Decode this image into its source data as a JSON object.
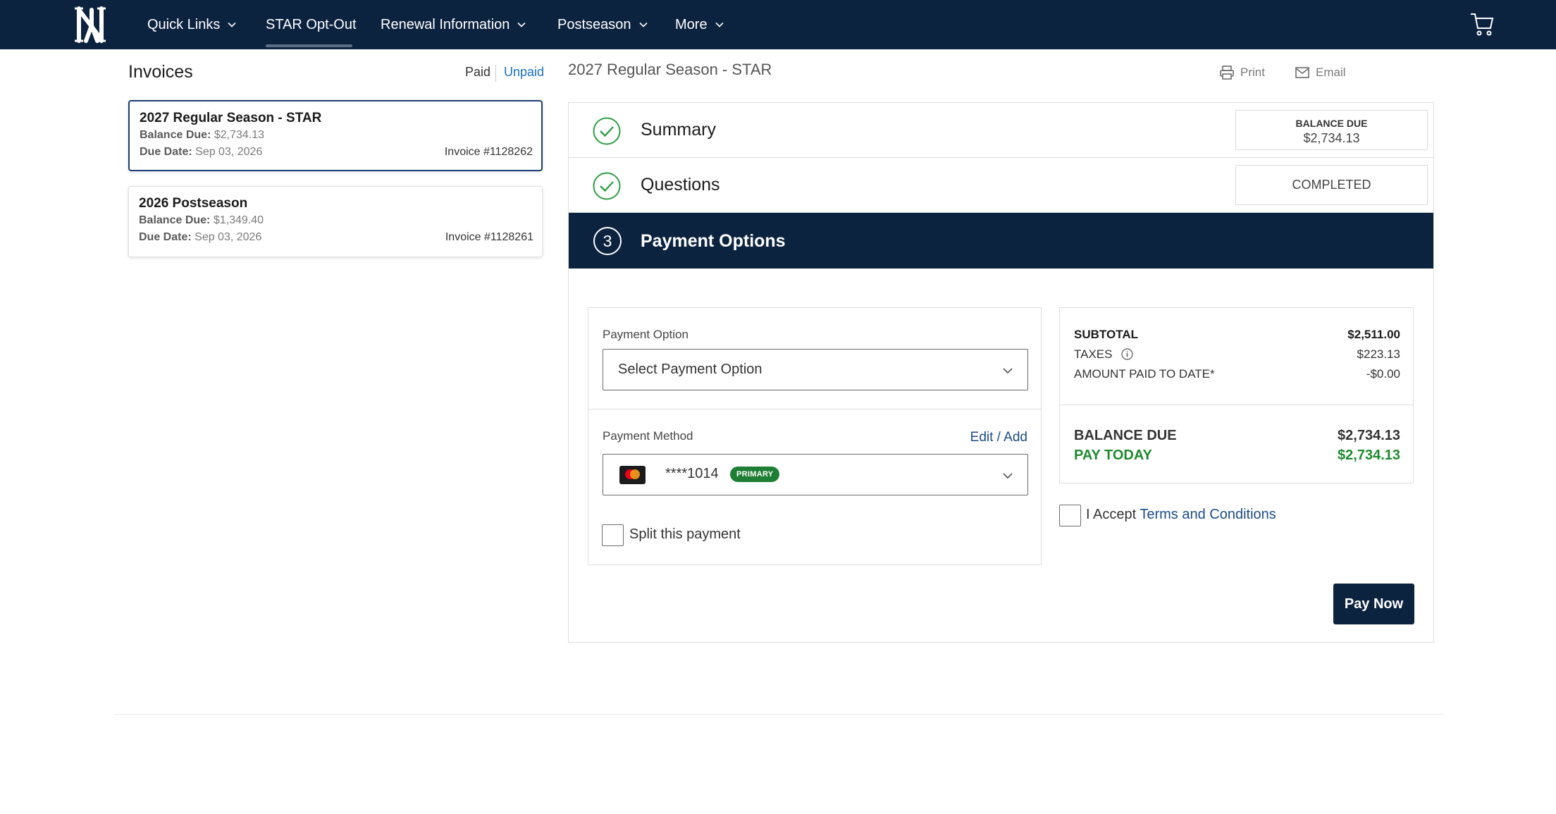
{
  "nav": {
    "items": [
      {
        "label": "Quick Links",
        "has_menu": true
      },
      {
        "label": "STAR Opt-Out",
        "has_menu": false,
        "active": true
      },
      {
        "label": "Renewal Information",
        "has_menu": true
      },
      {
        "label": "Postseason",
        "has_menu": true
      },
      {
        "label": "More",
        "has_menu": true
      }
    ],
    "logo_icon": "ny-logo",
    "cart_icon": "cart-icon"
  },
  "invoices": {
    "title": "Invoices",
    "filter_paid": "Paid",
    "filter_unpaid": "Unpaid",
    "list": [
      {
        "name": "2027 Regular Season - STAR",
        "balance_label": "Balance Due:",
        "balance": "$2,734.13",
        "due_label": "Due Date:",
        "due": "Sep 03, 2026",
        "invoice": "Invoice #1128262",
        "selected": true
      },
      {
        "name": "2026 Postseason",
        "balance_label": "Balance Due:",
        "balance": "$1,349.40",
        "due_label": "Due Date:",
        "due": "Sep 03, 2026",
        "invoice": "Invoice #1128261",
        "selected": false
      }
    ]
  },
  "main": {
    "title": "2027 Regular Season - STAR",
    "print_label": "Print",
    "email_label": "Email",
    "steps": {
      "summary": {
        "title": "Summary",
        "status_label": "BALANCE DUE",
        "status_value": "$2,734.13"
      },
      "questions": {
        "title": "Questions",
        "status": "COMPLETED"
      },
      "payment": {
        "number": "3",
        "title": "Payment Options"
      }
    },
    "form": {
      "payment_option_label": "Payment Option",
      "payment_option_value": "Select Payment Option",
      "payment_method_label": "Payment Method",
      "edit_add": "Edit / Add",
      "card_number": "****1014",
      "card_badge": "PRIMARY",
      "split_label": "Split this payment"
    },
    "totals": {
      "subtotal_label": "SUBTOTAL",
      "subtotal": "$2,511.00",
      "taxes_label": "TAXES",
      "taxes": "$223.13",
      "paid_label": "AMOUNT PAID TO DATE*",
      "paid": "-$0.00",
      "balance_label": "BALANCE DUE",
      "balance": "$2,734.13",
      "pay_today_label": "PAY TODAY",
      "pay_today": "$2,734.13"
    },
    "terms": {
      "prefix": "I Accept",
      "link": "Terms and Conditions"
    },
    "pay_button": "Pay Now"
  },
  "colors": {
    "navy": "#0c2340",
    "link": "#1a6fc2",
    "green": "#1e8a2f",
    "badge_green": "#1e7e34"
  }
}
